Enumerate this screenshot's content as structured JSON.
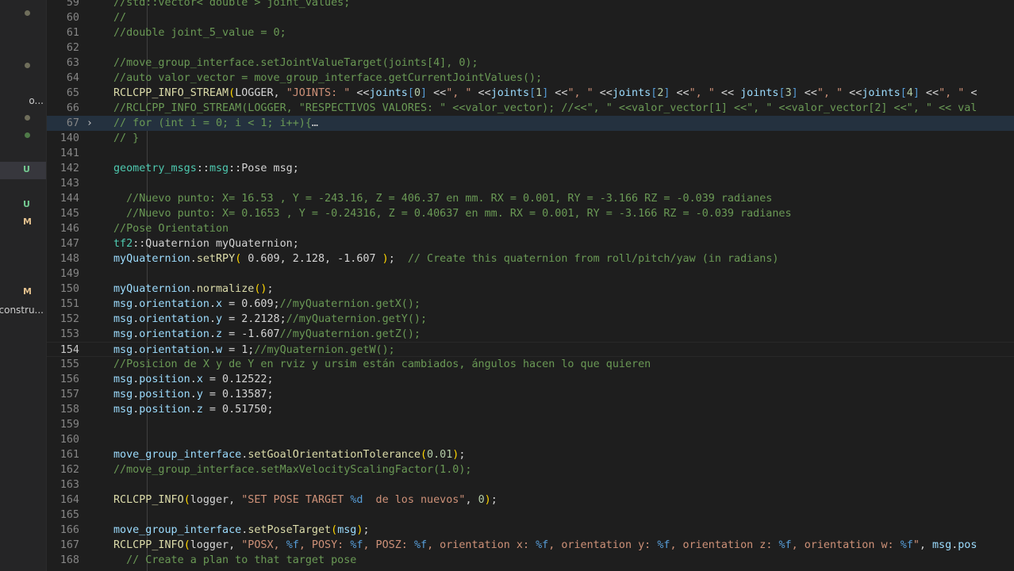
{
  "explorer": {
    "rows": [
      {
        "kind": "dot",
        "color": "#6f6e5b"
      },
      {
        "kind": "dot",
        "color": "#6f6e5b"
      },
      {
        "kind": "text",
        "text": "o...",
        "dot_color": "#6f6e5b"
      },
      {
        "kind": "dot",
        "color": "#6f6e5b"
      },
      {
        "kind": "dot",
        "color": "#4f7a48"
      },
      {
        "kind": "badge",
        "text": "U",
        "color": "#73c991",
        "selected": true
      },
      {
        "kind": "badge",
        "text": "U",
        "color": "#73c991"
      },
      {
        "kind": "badge",
        "text": "M",
        "color": "#e2c08d"
      },
      {
        "kind": "badge",
        "text": "M",
        "color": "#e2c08d"
      },
      {
        "kind": "text",
        "text": "constru..."
      }
    ]
  },
  "editor": {
    "current_line": "154",
    "lines": [
      {
        "n": "59",
        "tokens": [
          {
            "t": "//std::vector< double > joint_values;",
            "c": "c"
          }
        ]
      },
      {
        "n": "60",
        "tokens": [
          {
            "t": "//",
            "c": "c"
          }
        ]
      },
      {
        "n": "61",
        "tokens": [
          {
            "t": "//double joint_5_value = 0;",
            "c": "c"
          }
        ]
      },
      {
        "n": "62",
        "tokens": []
      },
      {
        "n": "63",
        "tokens": [
          {
            "t": "//move_group_interface.setJointValueTarget(joints[4], 0);",
            "c": "c"
          }
        ]
      },
      {
        "n": "64",
        "tokens": [
          {
            "t": "//auto valor_vector = move_group_interface.getCurrentJointValues();",
            "c": "c"
          }
        ]
      },
      {
        "n": "65",
        "tokens": [
          {
            "t": "RCLCPP_INFO_STREAM",
            "c": "f"
          },
          {
            "t": "(",
            "c": "y"
          },
          {
            "t": "LOGGER, ",
            "c": "d"
          },
          {
            "t": "\"JOINTS: \"",
            "c": "s"
          },
          {
            "t": " <<",
            "c": "d"
          },
          {
            "t": "joints",
            "c": "v"
          },
          {
            "t": "[",
            "c": "k"
          },
          {
            "t": "0",
            "c": "n"
          },
          {
            "t": "]",
            "c": "k"
          },
          {
            "t": " <<",
            "c": "d"
          },
          {
            "t": "\", \"",
            "c": "s"
          },
          {
            "t": " <<",
            "c": "d"
          },
          {
            "t": "joints",
            "c": "v"
          },
          {
            "t": "[",
            "c": "k"
          },
          {
            "t": "1",
            "c": "n"
          },
          {
            "t": "]",
            "c": "k"
          },
          {
            "t": " <<",
            "c": "d"
          },
          {
            "t": "\", \"",
            "c": "s"
          },
          {
            "t": " <<",
            "c": "d"
          },
          {
            "t": "joints",
            "c": "v"
          },
          {
            "t": "[",
            "c": "k"
          },
          {
            "t": "2",
            "c": "n"
          },
          {
            "t": "]",
            "c": "k"
          },
          {
            "t": " <<",
            "c": "d"
          },
          {
            "t": "\", \"",
            "c": "s"
          },
          {
            "t": " << ",
            "c": "d"
          },
          {
            "t": "joints",
            "c": "v"
          },
          {
            "t": "[",
            "c": "k"
          },
          {
            "t": "3",
            "c": "n"
          },
          {
            "t": "]",
            "c": "k"
          },
          {
            "t": " <<",
            "c": "d"
          },
          {
            "t": "\", \"",
            "c": "s"
          },
          {
            "t": " <<",
            "c": "d"
          },
          {
            "t": "joints",
            "c": "v"
          },
          {
            "t": "[",
            "c": "k"
          },
          {
            "t": "4",
            "c": "n"
          },
          {
            "t": "]",
            "c": "k"
          },
          {
            "t": " <<",
            "c": "d"
          },
          {
            "t": "\", \"",
            "c": "s"
          },
          {
            "t": " <",
            "c": "d"
          }
        ]
      },
      {
        "n": "66",
        "tokens": [
          {
            "t": "//RCLCPP_INFO_STREAM(LOGGER, \"RESPECTIVOS VALORES: \" <<valor_vector); //<<\", \" <<valor_vector[1] <<\", \" <<valor_vector[2] <<\", \" << val",
            "c": "c"
          }
        ]
      },
      {
        "n": "67",
        "fold": "closed",
        "highlight": true,
        "tokens": [
          {
            "t": "// for (int i = 0; i < 1; i++){",
            "c": "c"
          },
          {
            "t": "…",
            "c": "d"
          }
        ]
      },
      {
        "n": "140",
        "tokens": [
          {
            "t": "// }",
            "c": "c"
          }
        ]
      },
      {
        "n": "141",
        "tokens": []
      },
      {
        "n": "142",
        "tokens": [
          {
            "t": "geometry_msgs",
            "c": "ty"
          },
          {
            "t": "::",
            "c": "d"
          },
          {
            "t": "msg",
            "c": "ty"
          },
          {
            "t": "::",
            "c": "d"
          },
          {
            "t": "Pose msg;",
            "c": "d"
          }
        ]
      },
      {
        "n": "143",
        "tokens": []
      },
      {
        "n": "144",
        "tokens": [
          {
            "t": "  //Nuevo punto: X= 16.53 , Y = -243.16, Z = 406.37 en mm. RX = 0.001, RY = -3.166 RZ = -0.039 radianes",
            "c": "c"
          }
        ]
      },
      {
        "n": "145",
        "tokens": [
          {
            "t": "  //Nuevo punto: X= 0.1653 , Y = -0.24316, Z = 0.40637 en mm. RX = 0.001, RY = -3.166 RZ = -0.039 radianes",
            "c": "c"
          }
        ]
      },
      {
        "n": "146",
        "tokens": [
          {
            "t": "//Pose Orientation",
            "c": "c"
          }
        ]
      },
      {
        "n": "147",
        "tokens": [
          {
            "t": "tf2",
            "c": "ty"
          },
          {
            "t": "::Quaternion myQuaternion;",
            "c": "d"
          }
        ]
      },
      {
        "n": "148",
        "tokens": [
          {
            "t": "myQuaternion",
            "c": "v"
          },
          {
            "t": ".",
            "c": "d"
          },
          {
            "t": "setRPY",
            "c": "f"
          },
          {
            "t": "(",
            "c": "y"
          },
          {
            "t": " 0.609, 2.128, -1.607 ",
            "c": "d"
          },
          {
            "t": ")",
            "c": "y"
          },
          {
            "t": ";  ",
            "c": "d"
          },
          {
            "t": "// Create this quaternion from roll/pitch/yaw (in radians)",
            "c": "c"
          }
        ]
      },
      {
        "n": "149",
        "tokens": []
      },
      {
        "n": "150",
        "tokens": [
          {
            "t": "myQuaternion",
            "c": "v"
          },
          {
            "t": ".",
            "c": "d"
          },
          {
            "t": "normalize",
            "c": "f"
          },
          {
            "t": "()",
            "c": "y"
          },
          {
            "t": ";",
            "c": "d"
          }
        ]
      },
      {
        "n": "151",
        "tokens": [
          {
            "t": "msg",
            "c": "v"
          },
          {
            "t": ".",
            "c": "d"
          },
          {
            "t": "orientation",
            "c": "v"
          },
          {
            "t": ".",
            "c": "d"
          },
          {
            "t": "x",
            "c": "v"
          },
          {
            "t": " = 0.609;",
            "c": "d"
          },
          {
            "t": "//myQuaternion.getX();",
            "c": "c"
          }
        ]
      },
      {
        "n": "152",
        "tokens": [
          {
            "t": "msg",
            "c": "v"
          },
          {
            "t": ".",
            "c": "d"
          },
          {
            "t": "orientation",
            "c": "v"
          },
          {
            "t": ".",
            "c": "d"
          },
          {
            "t": "y",
            "c": "v"
          },
          {
            "t": " = 2.2128;",
            "c": "d"
          },
          {
            "t": "//myQuaternion.getY();",
            "c": "c"
          }
        ]
      },
      {
        "n": "153",
        "tokens": [
          {
            "t": "msg",
            "c": "v"
          },
          {
            "t": ".",
            "c": "d"
          },
          {
            "t": "orientation",
            "c": "v"
          },
          {
            "t": ".",
            "c": "d"
          },
          {
            "t": "z",
            "c": "v"
          },
          {
            "t": " = -1.607",
            "c": "d"
          },
          {
            "t": "//myQuaternion.getZ();",
            "c": "c"
          }
        ]
      },
      {
        "n": "154",
        "current": true,
        "tokens": [
          {
            "t": "msg",
            "c": "v"
          },
          {
            "t": ".",
            "c": "d"
          },
          {
            "t": "orientation",
            "c": "v"
          },
          {
            "t": ".",
            "c": "d"
          },
          {
            "t": "w",
            "c": "v"
          },
          {
            "t": " = 1;",
            "c": "d"
          },
          {
            "t": "//myQuaternion.getW();",
            "c": "c"
          }
        ]
      },
      {
        "n": "155",
        "tokens": [
          {
            "t": "//Posicion de X y de Y en rviz y ursim están cambiados, ángulos hacen lo que quieren",
            "c": "c"
          }
        ]
      },
      {
        "n": "156",
        "tokens": [
          {
            "t": "msg",
            "c": "v"
          },
          {
            "t": ".",
            "c": "d"
          },
          {
            "t": "position",
            "c": "v"
          },
          {
            "t": ".",
            "c": "d"
          },
          {
            "t": "x",
            "c": "v"
          },
          {
            "t": " = 0.12522;",
            "c": "d"
          }
        ]
      },
      {
        "n": "157",
        "tokens": [
          {
            "t": "msg",
            "c": "v"
          },
          {
            "t": ".",
            "c": "d"
          },
          {
            "t": "position",
            "c": "v"
          },
          {
            "t": ".",
            "c": "d"
          },
          {
            "t": "y",
            "c": "v"
          },
          {
            "t": " = 0.13587;",
            "c": "d"
          }
        ]
      },
      {
        "n": "158",
        "tokens": [
          {
            "t": "msg",
            "c": "v"
          },
          {
            "t": ".",
            "c": "d"
          },
          {
            "t": "position",
            "c": "v"
          },
          {
            "t": ".",
            "c": "d"
          },
          {
            "t": "z",
            "c": "v"
          },
          {
            "t": " = 0.51750;",
            "c": "d"
          }
        ]
      },
      {
        "n": "159",
        "tokens": []
      },
      {
        "n": "160",
        "tokens": []
      },
      {
        "n": "161",
        "tokens": [
          {
            "t": "move_group_interface",
            "c": "v"
          },
          {
            "t": ".",
            "c": "d"
          },
          {
            "t": "setGoalOrientationTolerance",
            "c": "f"
          },
          {
            "t": "(",
            "c": "y"
          },
          {
            "t": "0.01",
            "c": "n"
          },
          {
            "t": ")",
            "c": "y"
          },
          {
            "t": ";",
            "c": "d"
          }
        ]
      },
      {
        "n": "162",
        "tokens": [
          {
            "t": "//move_group_interface.setMaxVelocityScalingFactor(1.0);",
            "c": "c"
          }
        ]
      },
      {
        "n": "163",
        "tokens": []
      },
      {
        "n": "164",
        "tokens": [
          {
            "t": "RCLCPP_INFO",
            "c": "f"
          },
          {
            "t": "(",
            "c": "y"
          },
          {
            "t": "logger, ",
            "c": "d"
          },
          {
            "t": "\"SET POSE TARGET ",
            "c": "s"
          },
          {
            "t": "%d",
            "c": "k"
          },
          {
            "t": "  de los nuevos\"",
            "c": "s"
          },
          {
            "t": ", ",
            "c": "d"
          },
          {
            "t": "0",
            "c": "n"
          },
          {
            "t": ")",
            "c": "y"
          },
          {
            "t": ";",
            "c": "d"
          }
        ]
      },
      {
        "n": "165",
        "tokens": []
      },
      {
        "n": "166",
        "tokens": [
          {
            "t": "move_group_interface",
            "c": "v"
          },
          {
            "t": ".",
            "c": "d"
          },
          {
            "t": "setPoseTarget",
            "c": "f"
          },
          {
            "t": "(",
            "c": "y"
          },
          {
            "t": "msg",
            "c": "v"
          },
          {
            "t": ")",
            "c": "y"
          },
          {
            "t": ";",
            "c": "d"
          }
        ]
      },
      {
        "n": "167",
        "tokens": [
          {
            "t": "RCLCPP_INFO",
            "c": "f"
          },
          {
            "t": "(",
            "c": "y"
          },
          {
            "t": "logger, ",
            "c": "d"
          },
          {
            "t": "\"POSX, ",
            "c": "s"
          },
          {
            "t": "%f",
            "c": "k"
          },
          {
            "t": ", POSY: ",
            "c": "s"
          },
          {
            "t": "%f",
            "c": "k"
          },
          {
            "t": ", POSZ: ",
            "c": "s"
          },
          {
            "t": "%f",
            "c": "k"
          },
          {
            "t": ", orientation x: ",
            "c": "s"
          },
          {
            "t": "%f",
            "c": "k"
          },
          {
            "t": ", orientation y: ",
            "c": "s"
          },
          {
            "t": "%f",
            "c": "k"
          },
          {
            "t": ", orientation z: ",
            "c": "s"
          },
          {
            "t": "%f",
            "c": "k"
          },
          {
            "t": ", orientation w: ",
            "c": "s"
          },
          {
            "t": "%f",
            "c": "k"
          },
          {
            "t": "\"",
            "c": "s"
          },
          {
            "t": ", ",
            "c": "d"
          },
          {
            "t": "msg",
            "c": "v"
          },
          {
            "t": ".",
            "c": "d"
          },
          {
            "t": "pos",
            "c": "v"
          }
        ]
      },
      {
        "n": "168",
        "tokens": [
          {
            "t": "  // Create a plan to that target pose",
            "c": "c"
          }
        ]
      }
    ]
  }
}
